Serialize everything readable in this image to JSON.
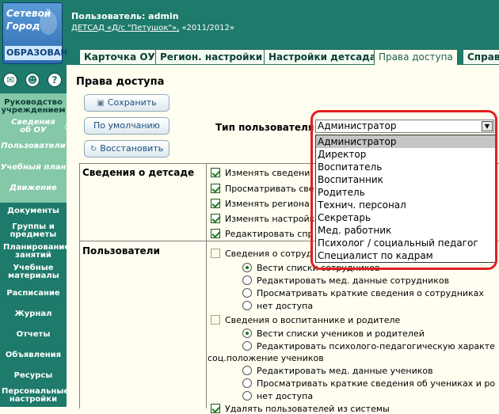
{
  "logo": {
    "line1": "Сетевой",
    "line2": "Город",
    "line3": "ОБРАЗОВАНИ"
  },
  "top_icons": [
    "envelope-icon",
    "users-icon",
    "help-icon"
  ],
  "header": {
    "user": "Пользователь: admin",
    "org": "ДЕТСАД «Д/с \"Петушок\"»,",
    "year": "«2011/2012»"
  },
  "sidebar": {
    "upper": [
      {
        "label": "Руководство учреждением"
      },
      {
        "label": "Сведения об ОУ"
      },
      {
        "label": "Пользователи"
      },
      {
        "label": "Учебный план"
      },
      {
        "label": "Движение"
      }
    ],
    "lower": [
      {
        "label": "Документы"
      },
      {
        "label": "Группы и предметы"
      },
      {
        "label": "Планирование занятий"
      },
      {
        "label": "Учебные материалы"
      },
      {
        "label": "Расписание"
      },
      {
        "label": "Журнал"
      },
      {
        "label": "Отчеты"
      },
      {
        "label": "Объявления"
      },
      {
        "label": "Ресурсы"
      },
      {
        "label": "Персональные настройки"
      }
    ]
  },
  "tabs": [
    {
      "label": "Карточка ОУ"
    },
    {
      "label": "Регион. настройки"
    },
    {
      "label": "Настройки детсада"
    },
    {
      "label": "Права доступа"
    },
    {
      "label": "Справ"
    }
  ],
  "page_title": "Права доступа",
  "buttons": {
    "save": "Сохранить",
    "default": "По умолчанию",
    "restore": "Восстановить"
  },
  "user_type": {
    "label": "Тип пользователя",
    "selected": "Администратор",
    "options": [
      "Администратор",
      "Директор",
      "Воспитатель",
      "Воспитанник",
      "Родитель",
      "Технич. персонал",
      "Секретарь",
      "Мед. работник",
      "Психолог / социальный педагог",
      "Специалист по кадрам"
    ]
  },
  "sections": {
    "kindergarten": {
      "title": "Сведения о детсаде",
      "items": [
        "Изменять сведени",
        "Просматривать све",
        "Изменять региона",
        "Изменять настройк",
        "Редактировать спр"
      ]
    },
    "users": {
      "title": "Пользователи",
      "staff_header": "Сведения о сотруд",
      "staff_options": [
        "Вести списки сотрудников",
        "Редактировать мед. данные сотрудников",
        "Просматривать краткие сведения о сотрудниках",
        "нет доступа"
      ],
      "pupils_header": "Сведения о воспитаннике и родителе",
      "pupils_options": [
        "Вести списки учеников и родителей",
        "Редактировать психолого-педагогическую характе",
        "Редактировать мед. данные учеников",
        "Просматривать краткие сведения об учениках и ро",
        "нет доступа"
      ],
      "pupils_wrap": "соц.положение учеников",
      "delete_users": "Удалять пользователей из системы"
    }
  }
}
